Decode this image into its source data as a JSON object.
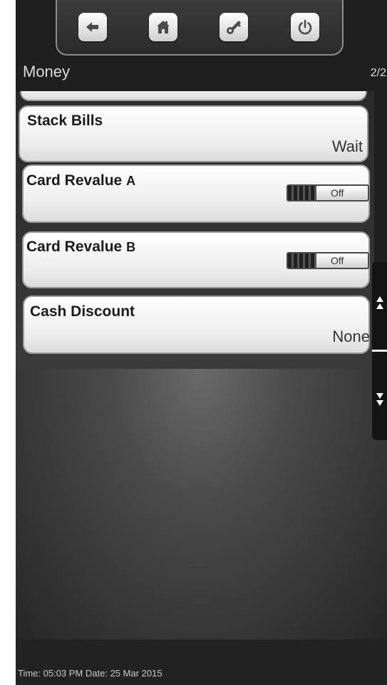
{
  "header": {
    "title": "Money",
    "page": "2/2"
  },
  "toolbar": {
    "buttons": [
      {
        "name": "back",
        "icon": "arrow-left-icon"
      },
      {
        "name": "home",
        "icon": "home-icon"
      },
      {
        "name": "key",
        "icon": "key-icon"
      },
      {
        "name": "power",
        "icon": "power-icon"
      }
    ]
  },
  "settings": [
    {
      "title": "Stack Bills",
      "value": "Wait"
    },
    {
      "title": "Card Revalue ",
      "suffix": "A",
      "toggle": "Off"
    },
    {
      "title": "Card Revalue ",
      "suffix": "B",
      "toggle": "Off"
    },
    {
      "title": "Cash Discount",
      "value": "None"
    }
  ],
  "scroll": {
    "up_icon": "double-chevron-up-icon",
    "down_icon": "double-chevron-down-icon"
  },
  "footer": {
    "datetime": "Time: 05:03 PM Date: 25 Mar 2015"
  },
  "colors": {
    "background": "#1f1f1f",
    "card": "#ececec",
    "text": "#1c1c1c"
  }
}
